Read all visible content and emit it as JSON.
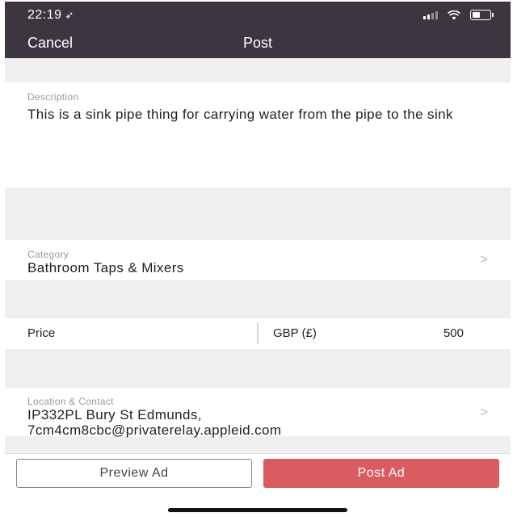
{
  "status_bar": {
    "time": "22:19",
    "location_icon": "location-arrow-icon",
    "signal_icon": "cellular-signal-icon",
    "wifi_icon": "wifi-icon",
    "battery_icon": "battery-icon"
  },
  "nav": {
    "cancel_label": "Cancel",
    "title": "Post"
  },
  "description": {
    "label": "Description",
    "value": "This is a sink pipe thing for carrying water from the pipe to the sink"
  },
  "category": {
    "label": "Category",
    "value": "Bathroom Taps & Mixers",
    "chevron": ">"
  },
  "price": {
    "label": "Price",
    "currency": "GBP (£)",
    "amount": "500"
  },
  "location_contact": {
    "label": "Location & Contact",
    "line1": "IP332PL Bury St Edmunds,",
    "line2": "7cm4cm8cbc@privaterelay.appleid.com",
    "chevron": ">"
  },
  "actions": {
    "preview_label": "Preview Ad",
    "post_label": "Post Ad"
  },
  "colors": {
    "header_bg": "#3d3641",
    "post_button": "#d95c61",
    "page_bg": "#efefef"
  }
}
